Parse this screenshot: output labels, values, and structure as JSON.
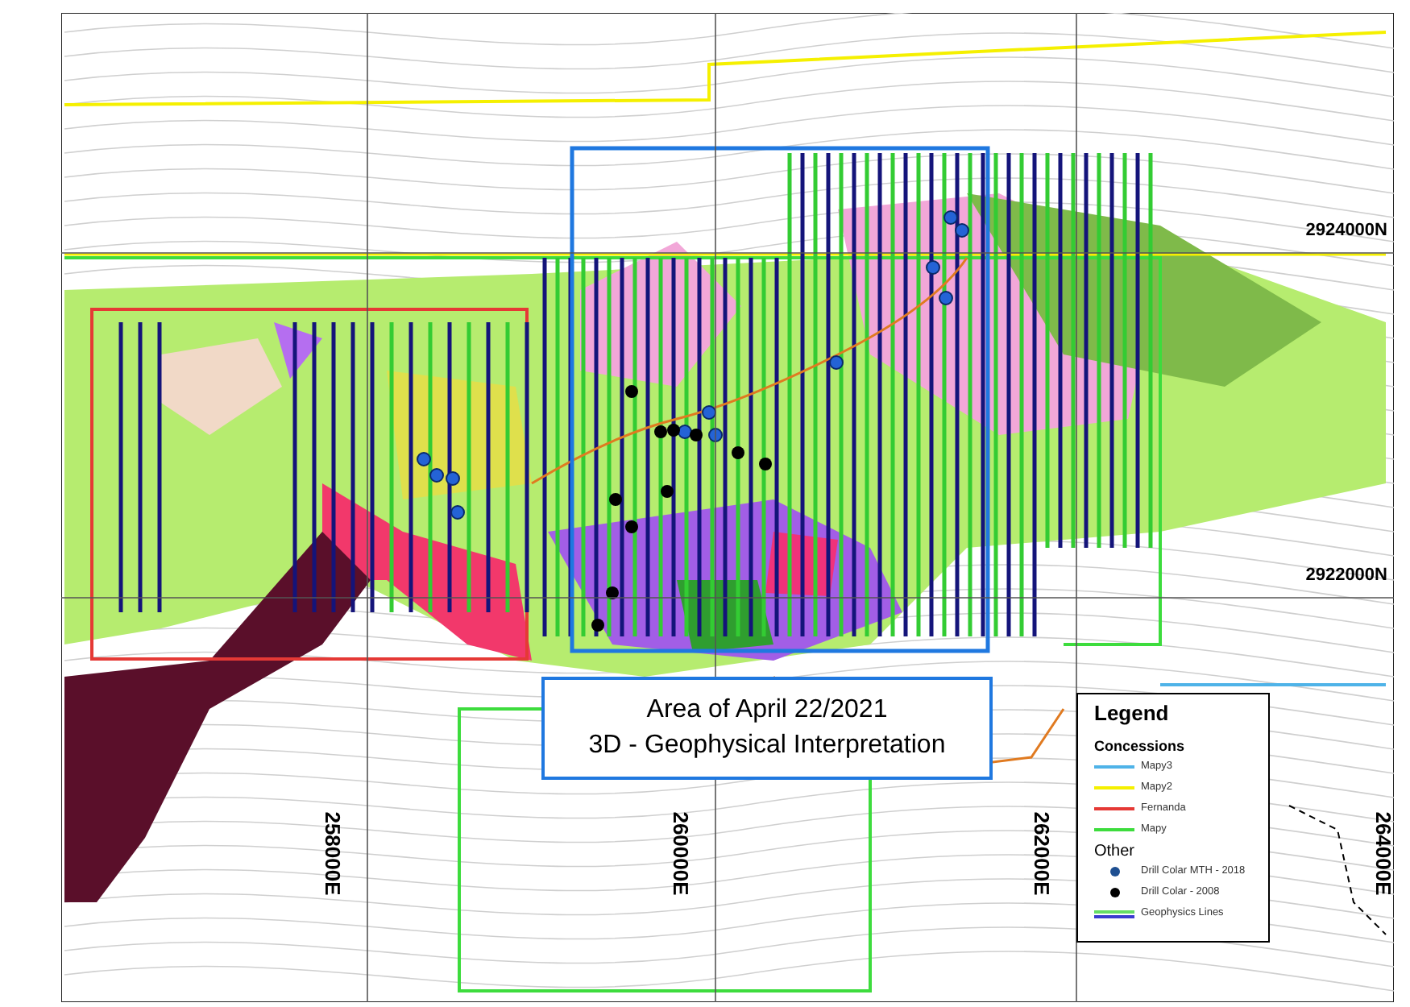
{
  "map": {
    "northings": [
      {
        "label": "2924000N"
      },
      {
        "label": "2922000N"
      }
    ],
    "eastings": [
      {
        "label": "258000E"
      },
      {
        "label": "260000E"
      },
      {
        "label": "262000E"
      },
      {
        "label": "264000E"
      }
    ]
  },
  "title_box": {
    "lines": [
      "Area of April 22/2021",
      "3D - Geophysical Interpretation"
    ]
  },
  "legend": {
    "title": "Legend",
    "sections": [
      {
        "heading": "Concessions",
        "bold": true,
        "items": [
          {
            "kind": "line",
            "label": "Mapy3",
            "color": "#4fb3e8"
          },
          {
            "kind": "line",
            "label": "Mapy2",
            "color": "#f5f000"
          },
          {
            "kind": "line",
            "label": "Fernanda",
            "color": "#e53935"
          },
          {
            "kind": "line",
            "label": "Mapy",
            "color": "#3ddc3d"
          }
        ]
      },
      {
        "heading": "Other",
        "bold": false,
        "items": [
          {
            "kind": "dot",
            "label": "Drill Colar MTH - 2018",
            "color": "#1e4f91"
          },
          {
            "kind": "dot",
            "label": "Drill Colar - 2008",
            "color": "#000000"
          },
          {
            "kind": "double-line",
            "label": "Geophysics Lines"
          }
        ]
      }
    ]
  }
}
